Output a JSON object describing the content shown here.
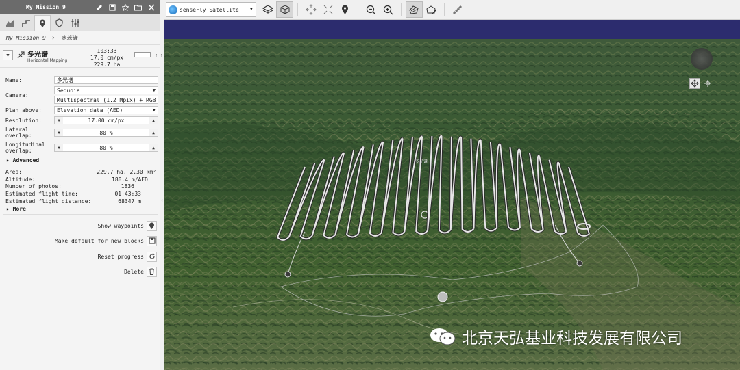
{
  "panel": {
    "mission_title": "My Mission 9",
    "breadcrumb": {
      "root": "My Mission 9",
      "current": "多光谱"
    },
    "block": {
      "name": "多光谱",
      "type": "Horizontal Mapping",
      "duration": "103:33",
      "resolution": "17.0 cm/px",
      "area": "229.7 ha",
      "progress": 0
    },
    "form": {
      "name_label": "Name:",
      "name_value": "多光谱",
      "camera_label": "Camera:",
      "camera_model": "Sequoia",
      "camera_mode": "Multispectral (1.2 Mpix) + RGB",
      "plan_label": "Plan above:",
      "plan_value": "Elevation data (AED)",
      "resolution_label": "Resolution:",
      "resolution_value": "17.00 cm/px",
      "lateral_label_1": "Lateral",
      "lateral_label_2": "overlap:",
      "lateral_value": "80 %",
      "long_label_1": "Longitudinal",
      "long_label_2": "overlap:",
      "long_value": "80 %",
      "advanced_label": "Advanced"
    },
    "info": [
      {
        "label": "Area:",
        "value": "229.7 ha, 2.30 km²"
      },
      {
        "label": "Altitude:",
        "value": "180.4 m/AED"
      },
      {
        "label": "Number of photos:",
        "value": "1836"
      },
      {
        "label": "Estimated flight time:",
        "value": "01:43:33"
      },
      {
        "label": "Estimated flight distance:",
        "value": "68347 m"
      }
    ],
    "more_label": "More",
    "actions": {
      "show_waypoints": "Show waypoints",
      "make_default": "Make default for new blocks",
      "reset_progress": "Reset progress",
      "delete": "Delete"
    }
  },
  "toolbar": {
    "map_source": "senseFly Satellite"
  },
  "map": {
    "block_label": "多光谱",
    "watermark": "北京天弘基业科技发展有限公司",
    "sky_color": "#2c2c6e",
    "flight_line_color": "#e6e6e6"
  }
}
